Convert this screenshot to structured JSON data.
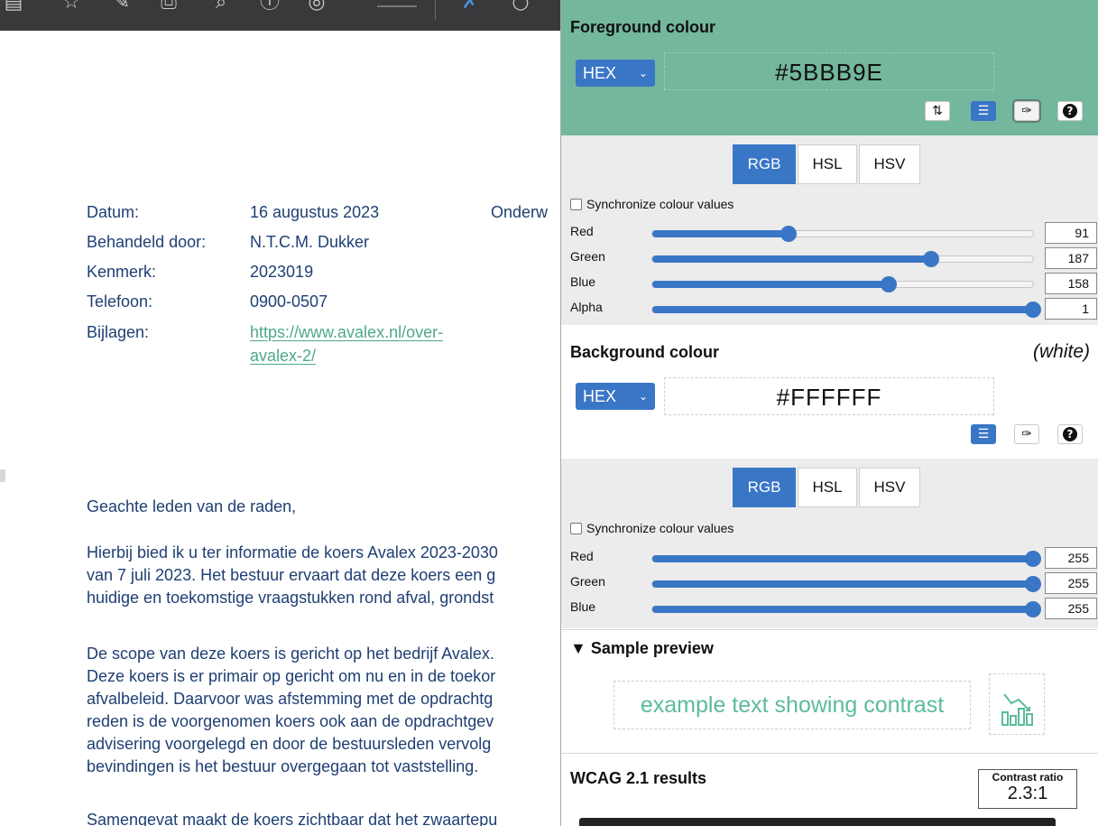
{
  "toolbar": {
    "icons": [
      "sidebar-icon",
      "bookmark-icon",
      "pen-icon",
      "print-icon",
      "zoom-icon",
      "info-icon",
      "download-icon",
      "highlight-icon",
      "circle-icon"
    ]
  },
  "document": {
    "meta": [
      {
        "label": "Datum:",
        "value": "16 augustus 2023"
      },
      {
        "label": "Behandeld door:",
        "value": "N.T.C.M. Dukker"
      },
      {
        "label": "Kenmerk:",
        "value": "2023019"
      },
      {
        "label": "Telefoon:",
        "value": "0900-0507"
      },
      {
        "label": "Bijlagen:",
        "value_line1": "https://www.avalex.nl/over-",
        "value_line2": "avalex-2/"
      }
    ],
    "onderwerp_fragment": "Onderw",
    "salutation": "Geachte leden van de raden,",
    "para1": [
      "Hierbij bied ik u ter informatie de koers Avalex 2023-2030",
      "van 7 juli 2023. Het bestuur ervaart dat deze koers een g",
      "huidige en toekomstige vraagstukken rond afval, grondst"
    ],
    "para2": [
      "De scope van deze koers is gericht op het bedrijf Avalex.",
      "Deze koers is er primair op gericht om nu en in de toekor",
      "afvalbeleid. Daarvoor was afstemming met de opdrachtg",
      "reden is de voorgenomen koers ook aan de opdrachtgev",
      "advisering voorgelegd en door de bestuursleden vervolg",
      "bevindingen is het bestuur overgegaan tot vaststelling."
    ],
    "para3": "Samengevat maakt de koers zichtbaar dat het zwaartepu"
  },
  "panel": {
    "foreground": {
      "title": "Foreground colour",
      "format": "HEX",
      "hex": "#5BBB9E",
      "tools": [
        "swap-icon",
        "sliders-icon",
        "eyedropper-icon",
        "help-icon"
      ],
      "modes": [
        "RGB",
        "HSL",
        "HSV"
      ],
      "selected_mode": "RGB",
      "sync_label": "Synchronize colour values",
      "channels": [
        {
          "label": "Red",
          "value": "91",
          "fraction": 0.357
        },
        {
          "label": "Green",
          "value": "187",
          "fraction": 0.733
        },
        {
          "label": "Blue",
          "value": "158",
          "fraction": 0.62
        },
        {
          "label": "Alpha",
          "value": "1",
          "fraction": 1.0
        }
      ]
    },
    "background": {
      "title": "Background colour",
      "tag": "(white)",
      "format": "HEX",
      "hex": "#FFFFFF",
      "tools": [
        "sliders-icon",
        "eyedropper-icon",
        "help-icon"
      ],
      "modes": [
        "RGB",
        "HSL",
        "HSV"
      ],
      "selected_mode": "RGB",
      "sync_label": "Synchronize colour values",
      "channels": [
        {
          "label": "Red",
          "value": "255",
          "fraction": 1.0
        },
        {
          "label": "Green",
          "value": "255",
          "fraction": 1.0
        },
        {
          "label": "Blue",
          "value": "255",
          "fraction": 1.0
        }
      ]
    },
    "sample": {
      "title": "▼ Sample preview",
      "text": "example text showing contrast",
      "icon": "chart-icon"
    },
    "wcag": {
      "title": "WCAG 2.1 results",
      "ratio_label": "Contrast ratio",
      "ratio_value": "2.3:1"
    }
  },
  "colors": {
    "foreground": "#5BBB9E",
    "header_bg": "#73B79D",
    "accent": "#3A76C6",
    "doc_text": "#1F3F73",
    "link": "#4EA888"
  }
}
